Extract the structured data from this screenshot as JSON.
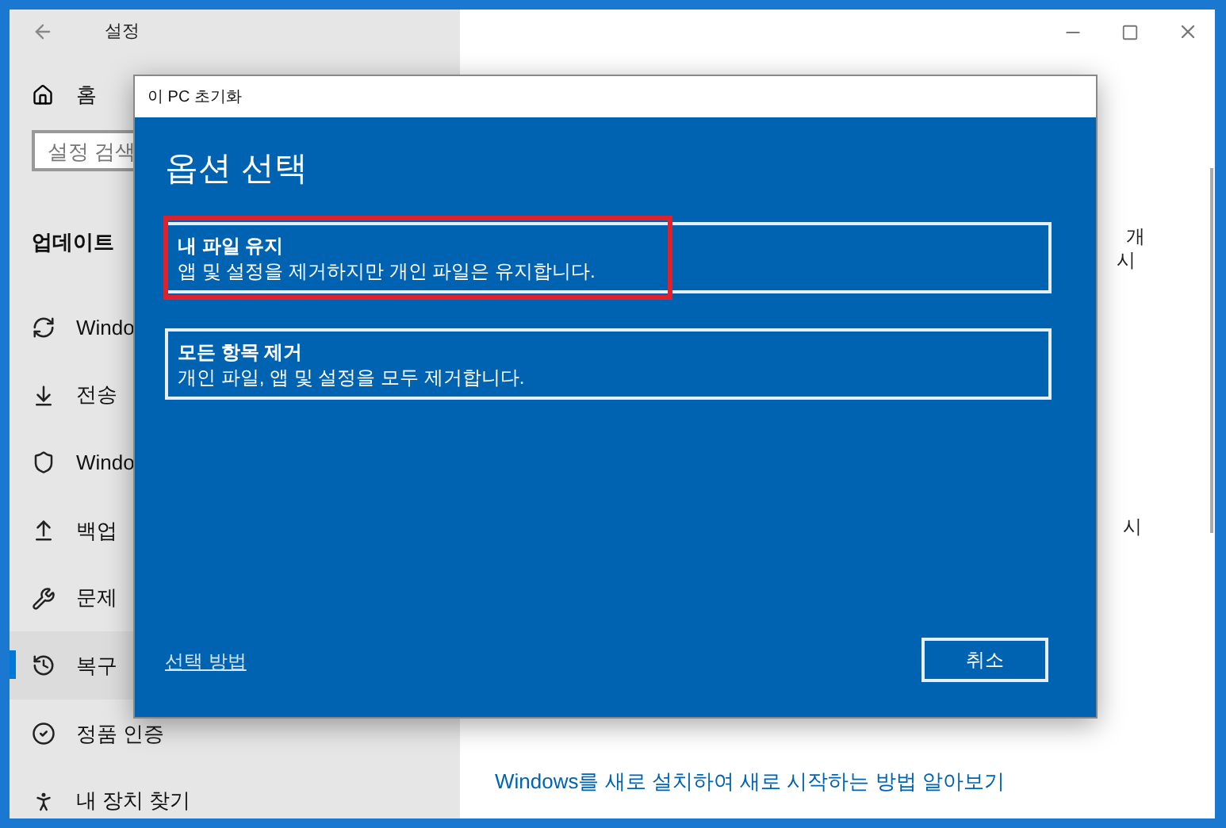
{
  "window": {
    "title": "설정"
  },
  "sidebar": {
    "home": "홈",
    "search": {
      "placeholder": "설정 검색"
    },
    "section": "업데이트",
    "items": [
      {
        "label": "Windo",
        "selected": false
      },
      {
        "label": "전송",
        "selected": false
      },
      {
        "label": "Windo",
        "selected": false
      },
      {
        "label": "백업",
        "selected": false
      },
      {
        "label": "문제",
        "selected": false
      },
      {
        "label": "복구",
        "selected": true
      },
      {
        "label": "정품 인증",
        "selected": false
      },
      {
        "label": "내 장치 찾기",
        "selected": false
      }
    ]
  },
  "content": {
    "fragments": [
      "개",
      "시",
      "시"
    ],
    "link": "Windows를 새로 설치하여 새로 시작하는 방법 알아보기"
  },
  "dialog": {
    "title": "이 PC 초기화",
    "heading": "옵션 선택",
    "options": [
      {
        "title": "내 파일 유지",
        "description": "앱 및 설정을 제거하지만 개인 파일은 유지합니다.",
        "highlighted": true
      },
      {
        "title": "모든 항목 제거",
        "description": "개인 파일, 앱 및 설정을 모두 제거합니다.",
        "highlighted": false
      }
    ],
    "help_link": "선택 방법",
    "cancel": "취소"
  }
}
